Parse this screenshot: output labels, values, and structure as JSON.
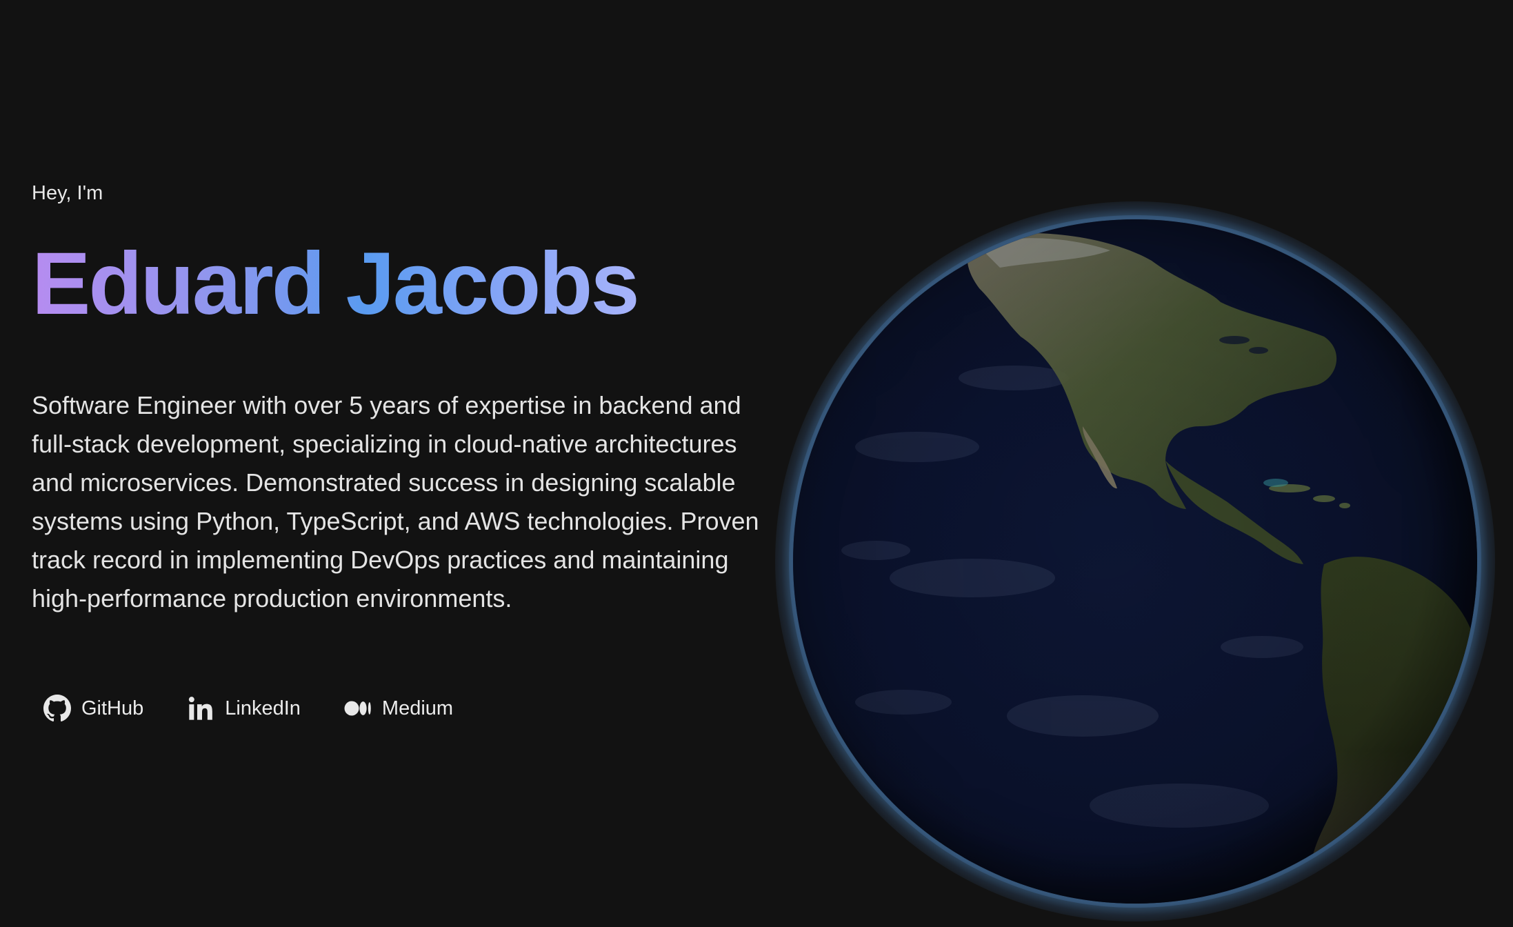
{
  "hero": {
    "greeting": "Hey, I'm",
    "name": "Eduard Jacobs",
    "bio": "Software Engineer with over 5 years of expertise in backend and full-stack development, specializing in cloud-native architectures and microservices. Demonstrated success in designing scalable systems using Python, TypeScript, and AWS technologies. Proven track record in implementing DevOps practices and maintaining high-performance production environments."
  },
  "socials": [
    {
      "label": "GitHub",
      "icon": "github-icon"
    },
    {
      "label": "LinkedIn",
      "icon": "linkedin-icon"
    },
    {
      "label": "Medium",
      "icon": "medium-icon"
    }
  ],
  "globe": {
    "icon": "earth-globe",
    "ocean_color": "#0b1330",
    "land_color": "#3a4428",
    "atmosphere_color": "#4678aa"
  },
  "colors": {
    "background": "#121212",
    "name_gradient_start": "#b68cf0",
    "name_gradient_mid": "#5a9bf0",
    "name_gradient_end": "#a7b3fa"
  }
}
